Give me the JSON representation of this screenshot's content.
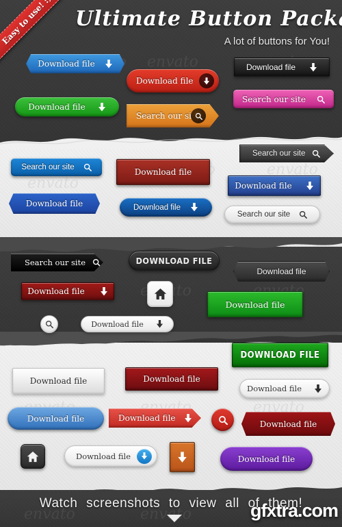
{
  "header": {
    "title": "Ultimate  Button  Package",
    "subtitle": "A lot of buttons for You!",
    "ribbon_label": "Easy to use! :)"
  },
  "footer": {
    "text": "Watch screenshots to view all of them!",
    "caret_icon": "caret-down-icon",
    "watermark": "gfxtra.com"
  },
  "watermark_text": "envato",
  "labels": {
    "download": "Download file",
    "download_caps": "DOWNLOAD FILE",
    "search": "Search our site"
  },
  "icons": {
    "download_arrow": "download-arrow-icon",
    "search": "search-icon",
    "home": "home-icon"
  },
  "colors": {
    "blue": "#1d66b8",
    "green": "#149614",
    "red": "#bb1f14",
    "orange": "#d4741a",
    "pink": "#c02589",
    "purple": "#5c1a9e",
    "dark": "#2b2b2b",
    "white": "#dcdcdc",
    "ribbon_red": "#b9201f"
  },
  "buttons": [
    {
      "id": "blue-hex-download",
      "label": "Download file",
      "icon": "download-arrow-icon"
    },
    {
      "id": "green-pill-download",
      "label": "Download file",
      "icon": "download-arrow-icon"
    },
    {
      "id": "red-pill-download",
      "label": "Download file",
      "icon": "download-arrow-icon"
    },
    {
      "id": "orange-arrow-search",
      "label": "Search our site",
      "icon": "search-icon"
    },
    {
      "id": "black-rect-download",
      "label": "Download file",
      "icon": "download-arrow-icon"
    },
    {
      "id": "pink-rect-search",
      "label": "Search our site",
      "icon": "search-icon"
    },
    {
      "id": "blue-round-search",
      "label": "Search our site",
      "icon": "search-icon"
    },
    {
      "id": "blue-hex-download-2",
      "label": "Download file",
      "icon": "none"
    },
    {
      "id": "red-rect-download",
      "label": "Download file",
      "icon": "none"
    },
    {
      "id": "navy-pill-download",
      "label": "Download file",
      "icon": "download-arrow-icon"
    },
    {
      "id": "dark-arrow-search",
      "label": "Search our site",
      "icon": "search-icon"
    },
    {
      "id": "blue-rect-download",
      "label": "Download file",
      "icon": "download-arrow-icon"
    },
    {
      "id": "white-pill-search",
      "label": "Search our site",
      "icon": "search-icon"
    },
    {
      "id": "black-arrow-search",
      "label": "Search our site",
      "icon": "search-icon"
    },
    {
      "id": "darkred-rect-download",
      "label": "Download file",
      "icon": "download-arrow-icon"
    },
    {
      "id": "circle-search",
      "label": "",
      "icon": "search-icon"
    },
    {
      "id": "white-pill-download",
      "label": "Download file",
      "icon": "download-arrow-icon"
    },
    {
      "id": "dark-pill-download-caps",
      "label": "DOWNLOAD FILE",
      "icon": "none"
    },
    {
      "id": "home-square-light",
      "label": "",
      "icon": "home-icon"
    },
    {
      "id": "dark-hex-download",
      "label": "Download file",
      "icon": "none"
    },
    {
      "id": "green-rect-download",
      "label": "Download file",
      "icon": "none"
    },
    {
      "id": "green-rect-download-caps",
      "label": "DOWNLOAD FILE",
      "icon": "none"
    },
    {
      "id": "white-rect-download",
      "label": "Download file",
      "icon": "none"
    },
    {
      "id": "darkred-rect-download-2",
      "label": "Download file",
      "icon": "none"
    },
    {
      "id": "white-pill-download-2",
      "label": "Download file",
      "icon": "download-arrow-icon"
    },
    {
      "id": "blue-pill-download",
      "label": "Download file",
      "icon": "none"
    },
    {
      "id": "red-arrow-download",
      "label": "Download file",
      "icon": "download-arrow-icon"
    },
    {
      "id": "red-circle-search",
      "label": "",
      "icon": "search-icon"
    },
    {
      "id": "darkred-hex-download",
      "label": "Download file",
      "icon": "none"
    },
    {
      "id": "home-square-dark",
      "label": "",
      "icon": "home-icon"
    },
    {
      "id": "white-pill-download-3",
      "label": "Download file",
      "icon": "download-arrow-icon"
    },
    {
      "id": "orange-square-download",
      "label": "",
      "icon": "download-arrow-icon"
    },
    {
      "id": "purple-pill-download",
      "label": "Download file",
      "icon": "none"
    }
  ]
}
